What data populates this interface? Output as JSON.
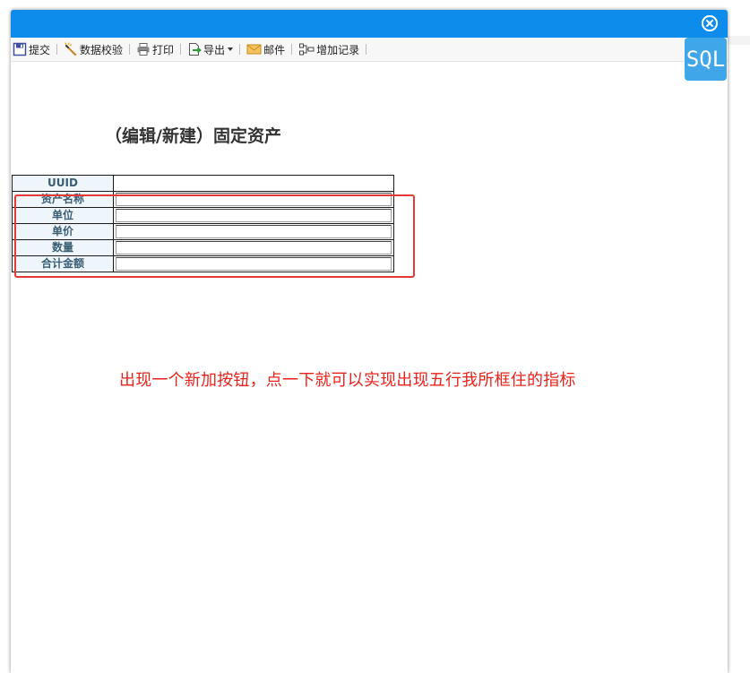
{
  "toolbar": {
    "items": [
      {
        "label": "提交",
        "icon": "save-icon"
      },
      {
        "label": "数据校验",
        "icon": "magic-wand-icon"
      },
      {
        "label": "打印",
        "icon": "printer-icon"
      },
      {
        "label": "导出",
        "icon": "export-icon"
      },
      {
        "label": "邮件",
        "icon": "mail-icon"
      },
      {
        "label": "增加记录",
        "icon": "add-record-icon"
      }
    ]
  },
  "sql_button": {
    "label": "SQL"
  },
  "form": {
    "title": "（编辑/新建）固定资产",
    "fields": [
      {
        "label": "UUID",
        "value": ""
      },
      {
        "label": "资产名称",
        "value": ""
      },
      {
        "label": "单位",
        "value": ""
      },
      {
        "label": "单价",
        "value": ""
      },
      {
        "label": "数量",
        "value": ""
      },
      {
        "label": "合计金额",
        "value": ""
      }
    ]
  },
  "annotation": {
    "text": "出现一个新加按钮，点一下就可以实现出现五行我所框住的指标",
    "color": "#e8231b"
  },
  "colors": {
    "titlebar": "#0d8cec",
    "sql_button": "#3ea6e9",
    "highlight": "#e53935"
  }
}
